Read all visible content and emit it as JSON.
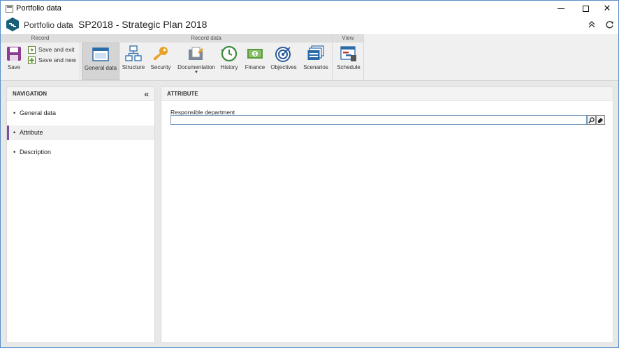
{
  "window": {
    "title": "Portfolio data"
  },
  "header": {
    "breadcrumb_root": "Portfolio data",
    "record_title": "SP2018 - Strategic Plan 2018"
  },
  "ribbon": {
    "groups": {
      "record": "Record",
      "record_data": "Record data",
      "view": "View"
    },
    "save": "Save",
    "save_and_exit": "Save and exit",
    "save_and_new": "Save and new",
    "general_data": "General data",
    "structure": "Structure",
    "security": "Security",
    "documentation": "Documentation",
    "history": "History",
    "finance": "Finance",
    "objectives": "Objectives",
    "scenarios": "Scenarios",
    "schedule": "Schedule"
  },
  "navigation": {
    "title": "NAVIGATION",
    "items": [
      {
        "label": "General data"
      },
      {
        "label": "Attribute"
      },
      {
        "label": "Description"
      }
    ]
  },
  "attribute": {
    "title": "ATTRIBUTE",
    "responsible_department_label": "Responsible department",
    "responsible_department_value": ""
  },
  "colors": {
    "accent": "#7b4fa0",
    "logo": "#1a5f7a"
  }
}
